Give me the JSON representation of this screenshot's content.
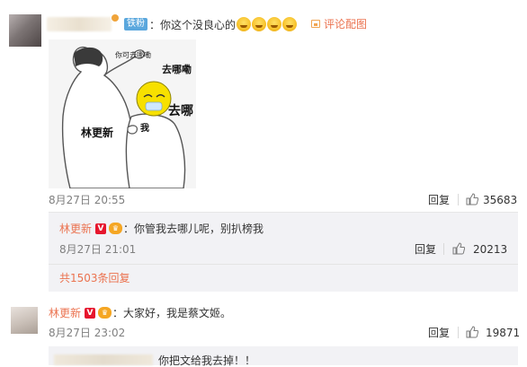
{
  "comment1": {
    "fan_badge": "铁粉",
    "text": "：你这个没良心的",
    "review_image_label": "评论配图",
    "meme": {
      "top_text": "你可去哪嘞",
      "right_text_1": "去哪嘞",
      "right_text_2": "去哪",
      "left_label": "林更新",
      "center_label": "我"
    },
    "date": "8月27日 20:55",
    "reply_label": "回复",
    "likes": "35683"
  },
  "reply1": {
    "user": "林更新",
    "text": "：你管我去哪儿呢，别扒榜我",
    "date": "8月27日 21:01",
    "reply_label": "回复",
    "likes": "20213",
    "more_replies": "共1503条回复"
  },
  "comment2": {
    "user": "林更新",
    "text": "：大家好，我是蔡文姬。",
    "date": "8月27日 23:02",
    "reply_label": "回复",
    "likes": "19871"
  },
  "bottom_reply": {
    "text": "你把文给我去掉！！"
  },
  "badges": {
    "vip": "V",
    "crown": "♛"
  }
}
